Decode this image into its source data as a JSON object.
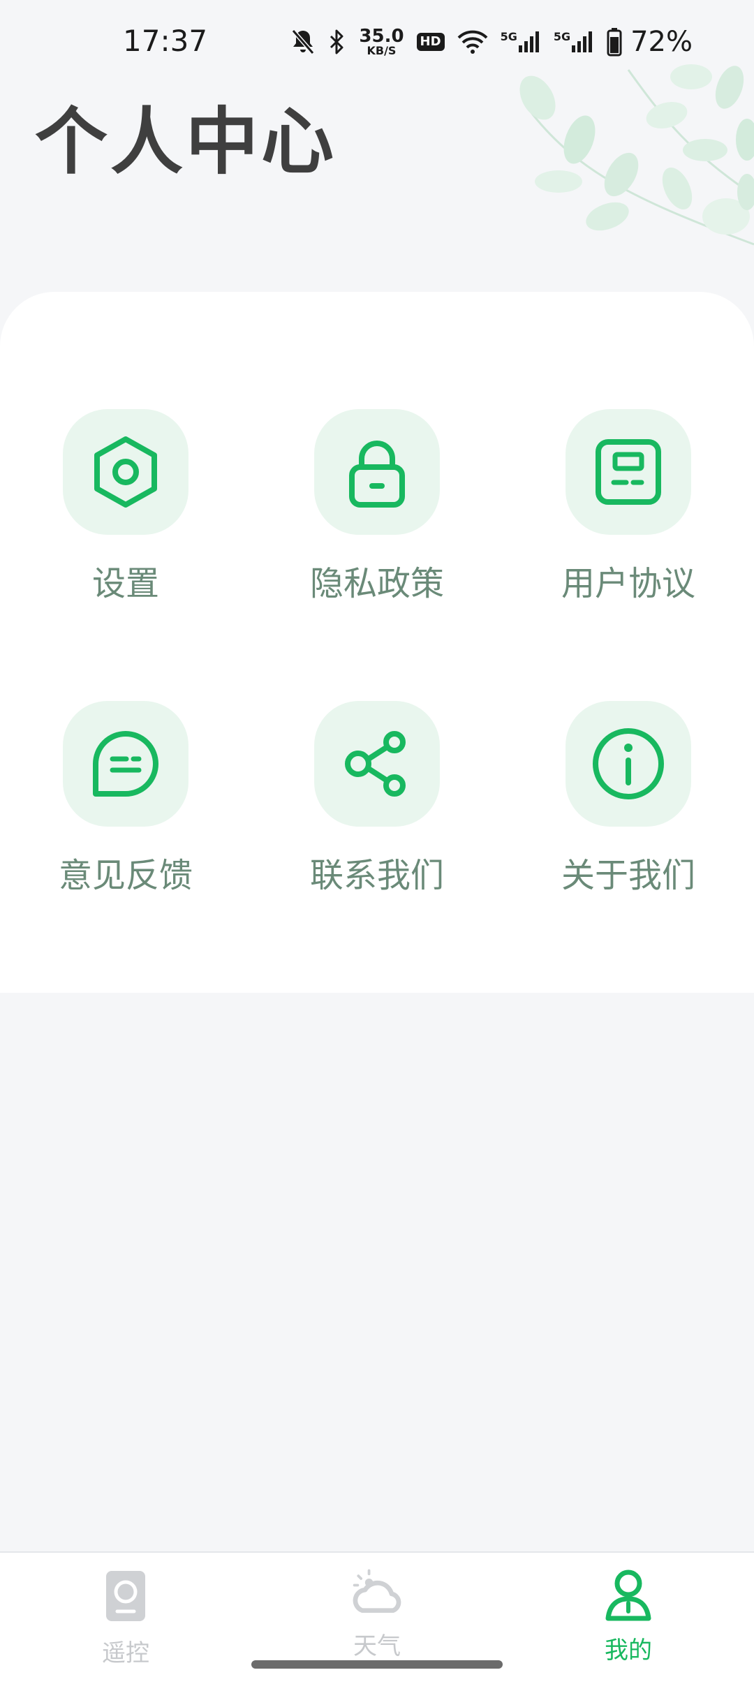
{
  "status_bar": {
    "time": "17:37",
    "net_speed_value": "35.0",
    "net_speed_unit": "KB/S",
    "hd_label": "HD",
    "signal1_label": "5G",
    "signal2_label": "5G",
    "battery_percent": "72%",
    "icons": [
      "bell-muted-icon",
      "bluetooth-icon",
      "wifi-icon",
      "cell-signal-icon",
      "battery-icon"
    ]
  },
  "header": {
    "title": "个人中心"
  },
  "menu": {
    "items": [
      {
        "label": "设置",
        "icon": "settings-hexagon-icon"
      },
      {
        "label": "隐私政策",
        "icon": "lock-icon"
      },
      {
        "label": "用户协议",
        "icon": "document-icon"
      },
      {
        "label": "意见反馈",
        "icon": "chat-bubble-icon"
      },
      {
        "label": "联系我们",
        "icon": "share-icon"
      },
      {
        "label": "关于我们",
        "icon": "info-icon"
      }
    ]
  },
  "bottom_nav": {
    "items": [
      {
        "label": "遥控",
        "icon": "remote-icon",
        "active": false
      },
      {
        "label": "天气",
        "icon": "weather-cloud-icon",
        "active": false
      },
      {
        "label": "我的",
        "icon": "profile-icon",
        "active": true
      }
    ]
  },
  "colors": {
    "accent": "#18b85f",
    "icon_tile": "#e9f6ee",
    "label": "#6a8a78",
    "inactive": "#c7c9cc",
    "background": "#f5f6f8"
  }
}
